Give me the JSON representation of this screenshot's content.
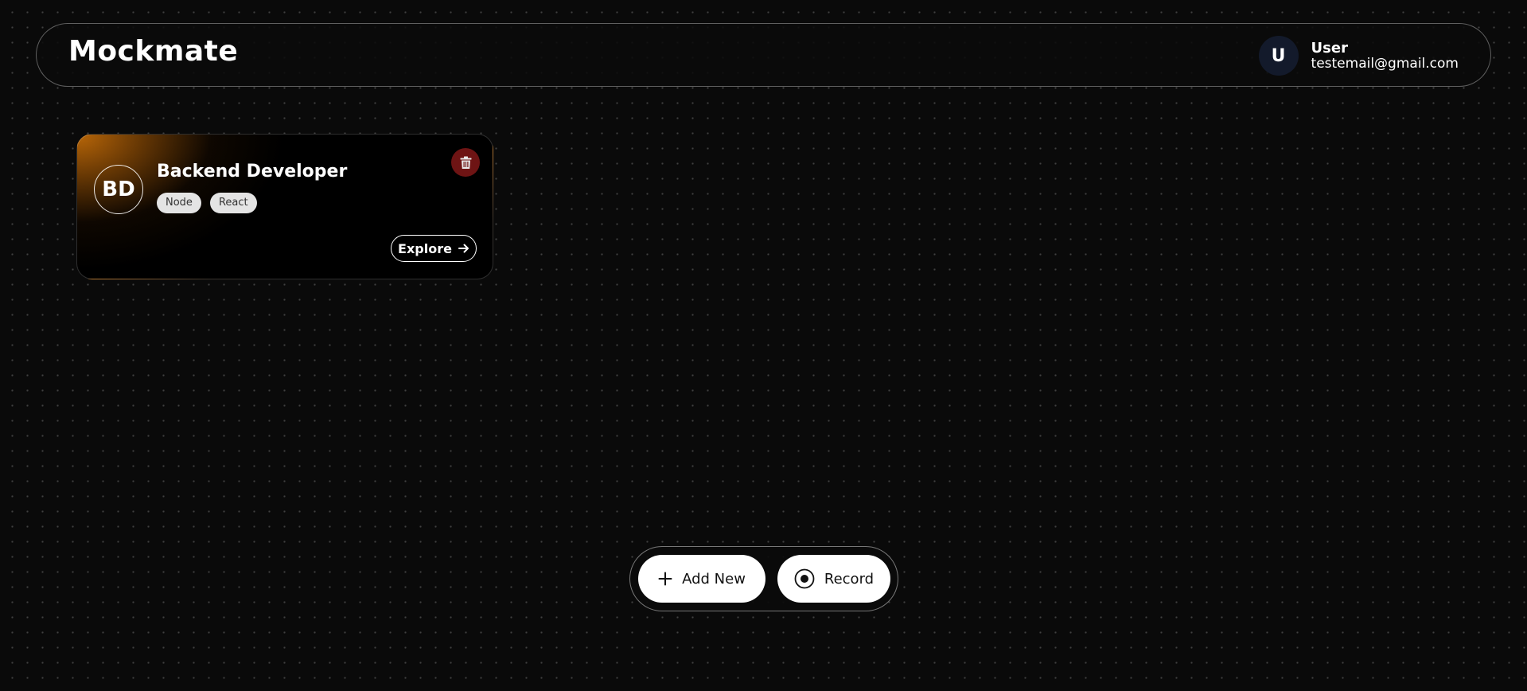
{
  "header": {
    "brand": "Mockmate",
    "user": {
      "initial": "U",
      "name": "User",
      "email": "testemail@gmail.com"
    }
  },
  "cards": [
    {
      "initials": "BD",
      "title": "Backend Developer",
      "tags": [
        "Node",
        "React"
      ],
      "explore_label": "Explore",
      "delete_icon": "trash-icon",
      "explore_icon": "arrow-right-icon"
    }
  ],
  "actions": {
    "add_label": "Add New",
    "add_icon": "plus-icon",
    "record_label": "Record",
    "record_icon": "record-icon"
  },
  "colors": {
    "background": "#0a0a0a",
    "card_accent": "#b86608",
    "delete_bg": "#6e1414",
    "avatar_bg": "#131a2b"
  }
}
